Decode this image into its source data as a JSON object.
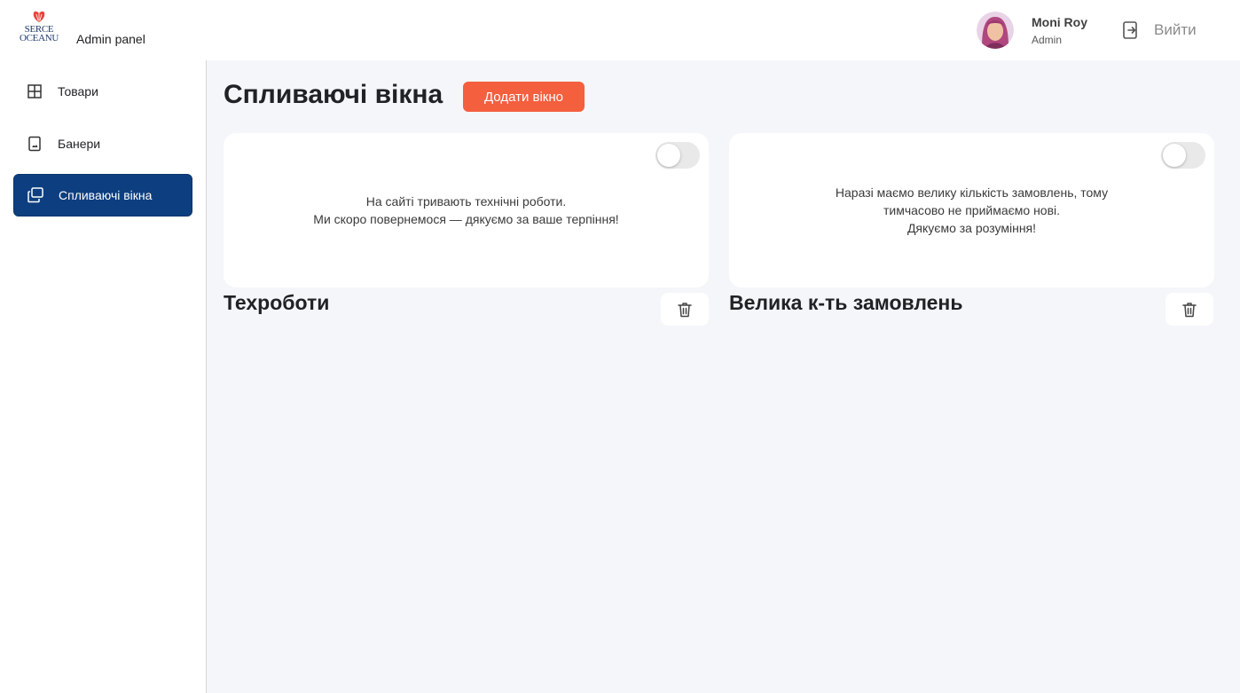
{
  "header": {
    "logo_text_line1": "SERCE",
    "logo_text_line2": "OCEANU",
    "panel_label": "Admin panel",
    "user": {
      "name": "Moni Roy",
      "role": "Admin"
    },
    "logout_label": "Вийти"
  },
  "sidebar": {
    "items": [
      {
        "label": "Товари",
        "icon": "grid-icon",
        "active": false
      },
      {
        "label": "Банери",
        "icon": "image-icon",
        "active": false
      },
      {
        "label": "Спливаючі вікна",
        "icon": "windows-icon",
        "active": true
      }
    ]
  },
  "main": {
    "title": "Спливаючі вікна",
    "add_button_label": "Додати вікно",
    "popups": [
      {
        "name": "Техроботи",
        "enabled": false,
        "lines": [
          "На сайті тривають технічні роботи.",
          "Ми скоро повернемося — дякуємо за ваше терпіння!"
        ]
      },
      {
        "name": "Велика к-ть замовлень",
        "enabled": false,
        "lines": [
          "Наразі маємо велику кількість замовлень, тому",
          "тимчасово не приймаємо нові.",
          "Дякуємо за розуміння!"
        ]
      }
    ]
  },
  "colors": {
    "accent": "#f45f3e",
    "active_nav": "#0d3f80",
    "background": "#f5f6fa",
    "logo_red": "#e8433a",
    "logo_blue": "#1d3a6b"
  }
}
